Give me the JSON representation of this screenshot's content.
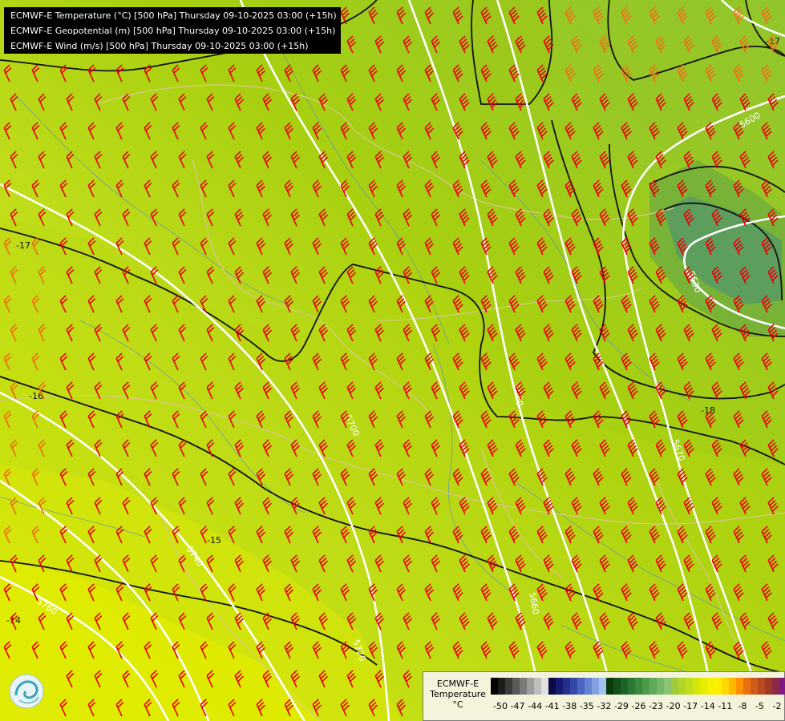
{
  "header": {
    "line1": "ECMWF-E Temperature (°C) [500 hPa] Thursday 09-10-2025 03:00 (+15h)",
    "line2": "ECMWF-E Geopotential (m) [500 hPa] Thursday 09-10-2025 03:00 (+15h)",
    "line3": "ECMWF-E Wind (m/s) [500 hPa] Thursday 09-10-2025 03:00 (+15h)"
  },
  "map": {
    "geopotential_labels": [
      "5600",
      "5630",
      "5660",
      "5670",
      "5660",
      "5700",
      "5720",
      "5740",
      "5760"
    ],
    "temperature_labels": [
      "-17",
      "-16",
      "-15",
      "-14",
      "-18",
      "-17"
    ],
    "barb_color": "#e8000c"
  },
  "legend": {
    "title_line1": "ECMWF-E",
    "title_line2": "Temperature",
    "unit": "°C",
    "ticks": [
      "-50",
      "-47",
      "-44",
      "-41",
      "-38",
      "-35",
      "-32",
      "-29",
      "-26",
      "-23",
      "-20",
      "-17",
      "-14",
      "-11",
      "-8",
      "-5",
      "-2"
    ],
    "colors": [
      "#000000",
      "#1c1c1c",
      "#3a3a3a",
      "#5a5a5a",
      "#7a7a7a",
      "#9c9c9c",
      "#bebebe",
      "#e0e0e0",
      "#0a0a46",
      "#161a70",
      "#22308e",
      "#3448a8",
      "#4a64c0",
      "#6482d4",
      "#82a2e2",
      "#a4c2ee",
      "#0a3c0a",
      "#14501a",
      "#1e6426",
      "#2a7832",
      "#3a8a3c",
      "#4c9a4a",
      "#60a85a",
      "#74b66a",
      "#8cc270",
      "#9ecc3c",
      "#b0d62a",
      "#c2de1a",
      "#d4e60c",
      "#e6ee00",
      "#f4f200",
      "#fff000",
      "#ffd800",
      "#ffb800",
      "#ff9000",
      "#e87010",
      "#d05a18",
      "#b84a20",
      "#a03a28",
      "#8a2a44",
      "#801a80",
      "#9a1aa8",
      "#7a1a88",
      "#5a1a70",
      "#48186a"
    ]
  },
  "colors": {
    "contour_black": "#111111",
    "contour_white": "#ffffff",
    "borders": "#d8c890",
    "rivers": "#5b8fbf"
  }
}
